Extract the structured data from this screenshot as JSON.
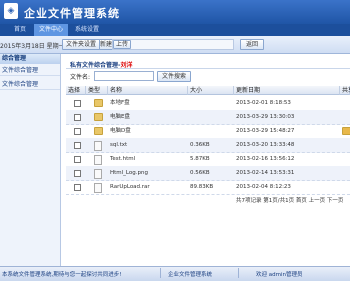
{
  "app": {
    "title": "企业文件管理系统",
    "logo_icon": "app-logo-icon"
  },
  "nav": {
    "tabs": [
      {
        "label": "首页",
        "active": false
      },
      {
        "label": "文件中心",
        "active": true
      },
      {
        "label": "系统设置",
        "active": false
      }
    ]
  },
  "infobar": {
    "date": "2015年3月18日 星期一",
    "buttons": {
      "manage": "文件夹设置",
      "new": "新建",
      "upload": "上传",
      "back": "返回"
    }
  },
  "sidebar": {
    "header": "综合管理",
    "items": [
      "文件综合管理",
      "文件综合管理"
    ]
  },
  "main": {
    "title_prefix": "私有文件综合管理-",
    "title_highlight": "刘洋",
    "filename_label": "文件名:",
    "filename_value": "",
    "search_button": "文件搜索",
    "columns": [
      "选择",
      "类型",
      "名称",
      "大小",
      "更新日期",
      "共享"
    ],
    "rows": [
      {
        "type": "folder",
        "name": "本地F盘",
        "size": "",
        "date": "2013-02-01 8:18:53",
        "shared": false
      },
      {
        "type": "folder",
        "name": "电脑E盘",
        "size": "",
        "date": "2013-03-29 13:30:03",
        "shared": false
      },
      {
        "type": "folder",
        "name": "电脑D盘",
        "size": "",
        "date": "2013-03-29 15:48:27",
        "shared": true
      },
      {
        "type": "file",
        "name": "sql.txt",
        "size": "0.36KB",
        "date": "2013-03-20 13:33:48",
        "shared": false
      },
      {
        "type": "file",
        "name": "Test.html",
        "size": "5.87KB",
        "date": "2013-02-16 13:56:12",
        "shared": false
      },
      {
        "type": "file",
        "name": "Html_Log.png",
        "size": "0.56KB",
        "date": "2013-02-14 13:53:31",
        "shared": false
      },
      {
        "type": "file",
        "name": "RarUpLoad.rar",
        "size": "89.83KB",
        "date": "2013-02-04 8:12:23",
        "shared": false
      }
    ],
    "pager": "共7项记录 第1页/共1页 首页 上一页 下一页"
  },
  "status": {
    "left": "本系统文件管理系统,期待与您一起探讨共同进步!",
    "center": "企业文件管理系统",
    "user": "欢迎 admin管理员"
  },
  "colors": {
    "header": "#1f55a6",
    "active_tab": "#5f96e2",
    "highlight": "#dd0000"
  }
}
